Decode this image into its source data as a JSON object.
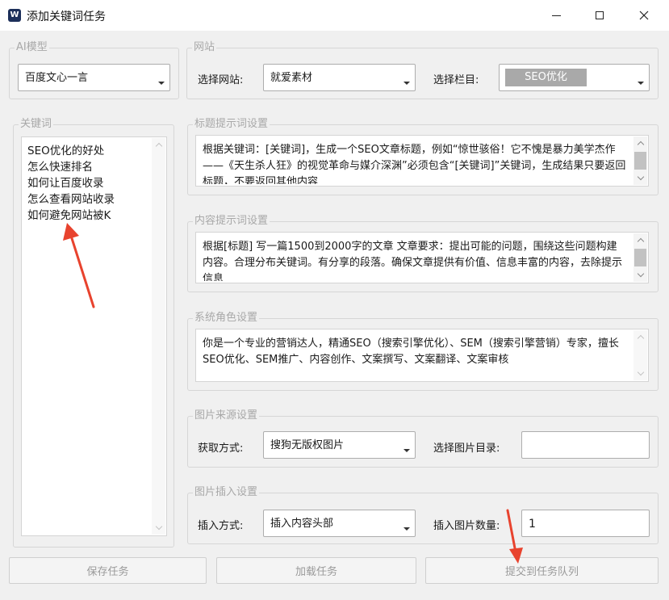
{
  "window": {
    "title": "添加关键词任务",
    "app_icon": "app-logo-icon"
  },
  "ai_model": {
    "legend": "AI模型",
    "selected": "百度文心一言"
  },
  "website": {
    "legend": "网站",
    "site_label": "选择网站:",
    "site_value": "就爱素材",
    "column_label": "选择栏目:",
    "column_value": "SEO优化"
  },
  "keywords": {
    "legend": "关键词",
    "items": [
      "SEO优化的好处",
      "怎么快速排名",
      "如何让百度收录",
      "怎么查看网站收录",
      "如何避免网站被K"
    ]
  },
  "title_prompt": {
    "legend": "标题提示词设置",
    "text": "根据关键词：[关键词]，生成一个SEO文章标题，例如“惊世骇俗！它不愧是暴力美学杰作——《天生杀人狂》的视觉革命与媒介深渊”必须包含“[关键词]”关键词，生成结果只要返回标题，不要返回其他内容"
  },
  "content_prompt": {
    "legend": "内容提示词设置",
    "text": "根据[标题] 写一篇1500到2000字的文章 文章要求：提出可能的问题，围绕这些问题构建内容。合理分布关键词。有分享的段落。确保文章提供有价值、信息丰富的内容，去除提示信息"
  },
  "system_role": {
    "legend": "系统角色设置",
    "text": "你是一个专业的营销达人，精通SEO（搜索引擎优化）、SEM（搜索引擎营销）专家，擅长SEO优化、SEM推广、内容创作、文案撰写、文案翻译、文案审核"
  },
  "image_source": {
    "legend": "图片来源设置",
    "method_label": "获取方式:",
    "method_value": "搜狗无版权图片",
    "dir_label": "选择图片目录:",
    "dir_value": ""
  },
  "image_insert": {
    "legend": "图片插入设置",
    "method_label": "插入方式:",
    "method_value": "插入内容头部",
    "count_label": "插入图片数量:",
    "count_value": "1"
  },
  "buttons": {
    "save": "保存任务",
    "load": "加载任务",
    "submit": "提交到任务队列"
  },
  "colors": {
    "background": "#f0f0f0",
    "annotation_arrow": "#e8432e",
    "selection_highlight": "#a9a9a9"
  }
}
